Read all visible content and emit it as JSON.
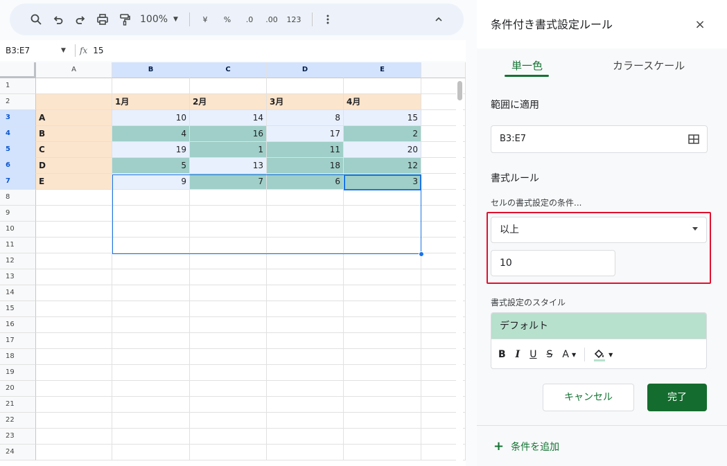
{
  "toolbar": {
    "zoom": "100%",
    "currency": "¥",
    "percent": "%",
    "dec_decrease": ".0",
    "dec_increase": ".00",
    "number_format": "123"
  },
  "formula_bar": {
    "name_box": "B3:E7",
    "fx": "fx",
    "value": "15"
  },
  "grid": {
    "columns": [
      "A",
      "B",
      "C",
      "D",
      "E"
    ],
    "row_numbers": [
      "1",
      "2",
      "3",
      "4",
      "5",
      "6",
      "7",
      "8",
      "9",
      "10",
      "11",
      "12",
      "13",
      "14",
      "15",
      "16",
      "17",
      "18",
      "19",
      "20",
      "21",
      "22",
      "23",
      "24"
    ],
    "header_row": [
      "",
      "1月",
      "2月",
      "3月",
      "4月"
    ],
    "data_rows": [
      [
        "A",
        "10",
        "14",
        "8",
        "15"
      ],
      [
        "B",
        "4",
        "16",
        "17",
        "2"
      ],
      [
        "C",
        "19",
        "1",
        "11",
        "20"
      ],
      [
        "D",
        "5",
        "13",
        "18",
        "12"
      ],
      [
        "E",
        "9",
        "7",
        "6",
        "3"
      ]
    ],
    "colors": {
      "highlight": "#9fcfc8",
      "selection": "#e8f0fe",
      "header": "#fce5cd"
    }
  },
  "panel": {
    "title": "条件付き書式設定ルール",
    "close": "×",
    "tabs": {
      "single": "単一色",
      "scale": "カラースケール"
    },
    "range_label": "範囲に適用",
    "range_value": "B3:E7",
    "rules_label": "書式ルール",
    "condition_label": "セルの書式設定の条件...",
    "condition": "以上",
    "condition_value": "10",
    "style_label": "書式設定のスタイル",
    "style_preview": "デフォルト",
    "style_tools": {
      "bold": "B",
      "italic": "I",
      "underline": "U",
      "strike": "S",
      "text_color": "A",
      "dropdown": "▼"
    },
    "cancel": "キャンセル",
    "done": "完了",
    "add_rule": "条件を追加",
    "add_plus": "+"
  }
}
